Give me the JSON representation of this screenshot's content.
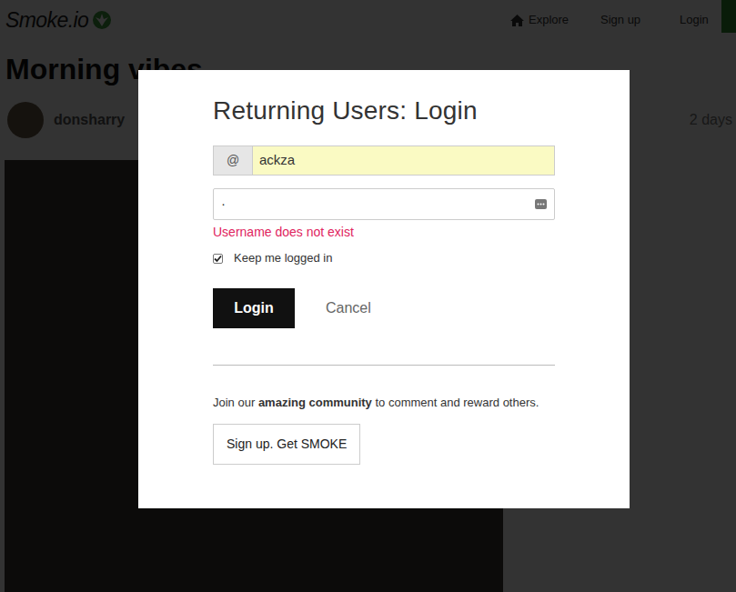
{
  "header": {
    "logo": "Smoke.io",
    "nav": [
      {
        "label": "Explore"
      },
      {
        "label": "Sign up"
      },
      {
        "label": "Login"
      }
    ]
  },
  "post": {
    "title": "Morning vibes",
    "author": "donsharry",
    "time": "2 days"
  },
  "modal": {
    "title": "Returning Users: Login",
    "username_prefix": "@",
    "username": "ackza",
    "password_mask": "·",
    "error": "Username does not exist",
    "keep_logged_in": {
      "label": "Keep me logged in",
      "checked": true
    },
    "login_button": "Login",
    "cancel_button": "Cancel",
    "join_text": {
      "before": "Join our ",
      "strong": "amazing community",
      "after": " to comment and reward others."
    },
    "signup_button": "Sign up. Get SMOKE"
  }
}
